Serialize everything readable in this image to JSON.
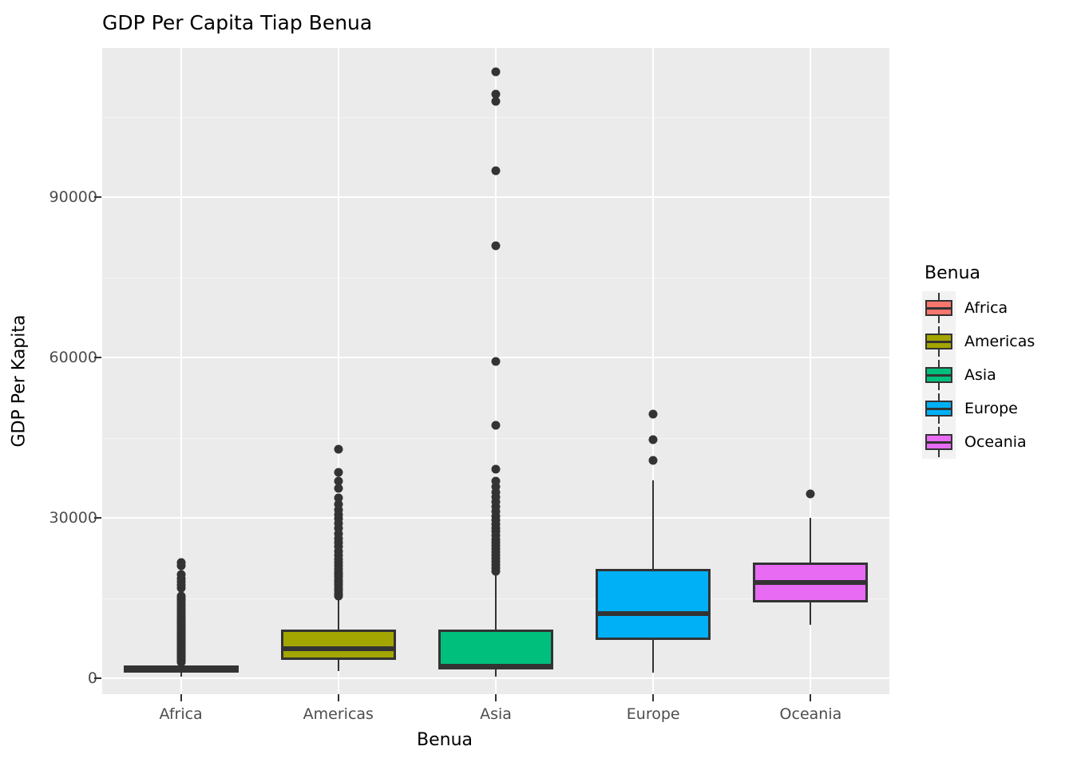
{
  "chart_data": {
    "type": "box",
    "title": "GDP Per Capita Tiap Benua",
    "xlabel": "Benua",
    "ylabel": "GDP Per Kapita",
    "categories": [
      "Africa",
      "Americas",
      "Asia",
      "Europe",
      "Oceania"
    ],
    "ylim": [
      -3000,
      118000
    ],
    "y_ticks": [
      0,
      30000,
      60000,
      90000
    ],
    "y_tick_labels": [
      "0",
      "30000",
      "60000",
      "90000"
    ],
    "grid": true,
    "legend": {
      "title": "Benua",
      "position": "right",
      "entries": [
        {
          "label": "Africa",
          "color": "#F8766D"
        },
        {
          "label": "Americas",
          "color": "#A3A500"
        },
        {
          "label": "Asia",
          "color": "#00BF7D"
        },
        {
          "label": "Europe",
          "color": "#00B0F6"
        },
        {
          "label": "Oceania",
          "color": "#E76BF3"
        }
      ]
    },
    "boxes": [
      {
        "category": "Africa",
        "color": "#F8766D",
        "lower_whisker": 241,
        "q1": 1206,
        "median": 1452,
        "q3": 2379,
        "upper_whisker": 2900,
        "outliers": [
          3000,
          3300,
          3450,
          3600,
          3800,
          3950,
          4100,
          4250,
          4400,
          4550,
          4700,
          4900,
          5100,
          5300,
          5500,
          5700,
          5900,
          6100,
          6300,
          6500,
          6700,
          6900,
          7100,
          7300,
          7500,
          7700,
          7900,
          8100,
          8300,
          8500,
          8700,
          8900,
          9200,
          9500,
          9800,
          10100,
          10400,
          10700,
          11000,
          11400,
          11800,
          12200,
          12600,
          13000,
          13400,
          13800,
          14200,
          14600,
          15000,
          15400,
          16900,
          17400,
          18000,
          18700,
          19400,
          21000,
          21700
        ]
      },
      {
        "category": "Americas",
        "color": "#A3A500",
        "lower_whisker": 1397,
        "q1": 3428,
        "median": 5466,
        "q3": 9084,
        "upper_whisker": 14700,
        "outliers": [
          15300,
          15800,
          16400,
          16900,
          17400,
          17900,
          18400,
          18900,
          19400,
          19900,
          20400,
          21000,
          21600,
          22300,
          23000,
          23800,
          24600,
          25400,
          26200,
          27000,
          28000,
          29000,
          29800,
          30600,
          31500,
          32600,
          33800,
          35500,
          36900,
          38600,
          42900
        ]
      },
      {
        "category": "Asia",
        "color": "#00BF7D",
        "lower_whisker": 331,
        "q1": 1557,
        "median": 2247,
        "q3": 9084,
        "upper_whisker": 19500,
        "outliers": [
          20000,
          20600,
          21200,
          21800,
          22400,
          23000,
          23600,
          24200,
          24800,
          25400,
          26000,
          26700,
          27400,
          28100,
          28800,
          29500,
          30300,
          31200,
          32100,
          33000,
          33900,
          34800,
          35800,
          36900,
          39200,
          47300,
          59300,
          80900,
          95000,
          108000,
          109400,
          113500
        ]
      },
      {
        "category": "Europe",
        "color": "#00B0F6",
        "lower_whisker": 973,
        "q1": 7213,
        "median": 12082,
        "q3": 20500,
        "upper_whisker": 37000,
        "outliers": [
          40700,
          44600,
          49400
        ]
      },
      {
        "category": "Oceania",
        "color": "#E76BF3",
        "lower_whisker": 10040,
        "q1": 14142,
        "median": 17983,
        "q3": 21600,
        "upper_whisker": 30000,
        "outliers": [
          34435
        ]
      }
    ]
  }
}
